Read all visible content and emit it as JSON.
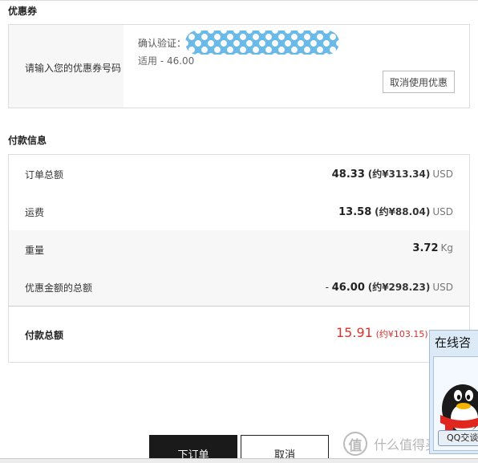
{
  "coupon": {
    "section_title": "优惠券",
    "input_prompt": "请输入您的优惠券号码",
    "confirm_label": "确认验证：",
    "applied_text": "适用 - 46.00",
    "cancel_button": "取消使用优惠"
  },
  "payment": {
    "section_title": "付款信息",
    "rows": [
      {
        "label": "订单总额",
        "prefix": "",
        "amount": "48.33",
        "cny": "(约¥313.34)",
        "unit": "USD"
      },
      {
        "label": "运费",
        "prefix": "",
        "amount": "13.58",
        "cny": "(约¥88.04)",
        "unit": "USD"
      },
      {
        "label": "重量",
        "prefix": "",
        "amount": "3.72",
        "cny": "",
        "unit": "Kg"
      },
      {
        "label": "优惠金额的总额",
        "prefix": "- ",
        "amount": "46.00",
        "cny": "(约¥298.23)",
        "unit": "USD"
      }
    ],
    "total_label": "付款总额",
    "total_amount": "15.91",
    "total_cny": "(约¥103.15)"
  },
  "actions": {
    "place_order": "下订单",
    "cancel": "取消"
  },
  "qq_widget": {
    "title": "在线咨",
    "button": "QQ交谈"
  },
  "watermark": {
    "logo_char": "值",
    "text": "什么值得买"
  },
  "colors": {
    "accent_red": "#d9342b",
    "dark_button": "#1a1a1a",
    "coupon_mask_blue": "#6bb9e6"
  }
}
